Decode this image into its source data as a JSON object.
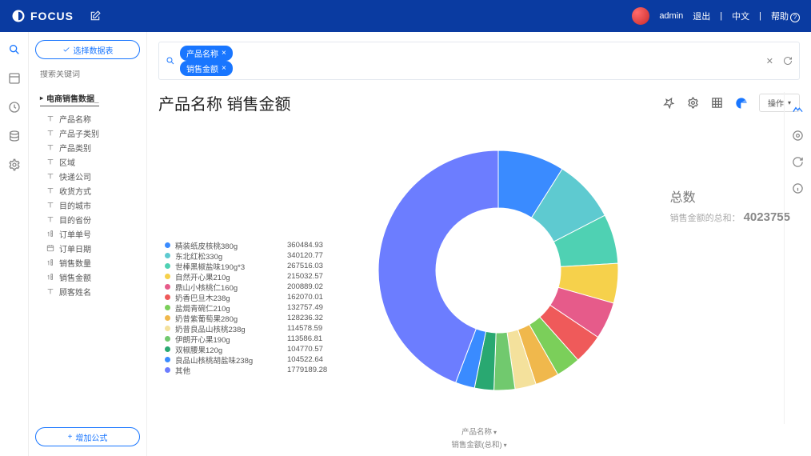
{
  "header": {
    "brand": "FOCUS",
    "user": "admin",
    "logout": "退出",
    "language": "中文",
    "help": "帮助"
  },
  "sidebar": {
    "selectDataBtn": "选择数据表",
    "searchPlaceholder": "搜索关键词",
    "treeTitle": "电商销售数据_",
    "fields": [
      {
        "label": "产品名称",
        "icon": "T"
      },
      {
        "label": "产品子类别",
        "icon": "T"
      },
      {
        "label": "产品类别",
        "icon": "T"
      },
      {
        "label": "区域",
        "icon": "T"
      },
      {
        "label": "快递公司",
        "icon": "T"
      },
      {
        "label": "收货方式",
        "icon": "T"
      },
      {
        "label": "目的城市",
        "icon": "T"
      },
      {
        "label": "目的省份",
        "icon": "T"
      },
      {
        "label": "订单单号",
        "icon": "num"
      },
      {
        "label": "订单日期",
        "icon": "cal"
      },
      {
        "label": "销售数量",
        "icon": "num"
      },
      {
        "label": "销售金额",
        "icon": "num"
      },
      {
        "label": "顾客姓名",
        "icon": "T"
      }
    ],
    "addFormula": "增加公式"
  },
  "chipbar": {
    "chips": [
      "产品名称",
      "销售金额"
    ]
  },
  "page": {
    "title": "产品名称 销售金额",
    "opBtn": "操作"
  },
  "summary": {
    "title": "总数",
    "label": "销售金额的总和：",
    "value": "4023755"
  },
  "axis": {
    "x": "产品名称",
    "y": "销售金额(总和)"
  },
  "chart_data": {
    "type": "pie",
    "title": "产品名称 销售金额",
    "series": [
      {
        "name": "精装纸皮核桃380g",
        "value": 360484.93,
        "color": "#3a8bff"
      },
      {
        "name": "东北红松330g",
        "value": 340120.77,
        "color": "#5ecad0"
      },
      {
        "name": "世棒黑椒盐味190g*3",
        "value": 267516.03,
        "color": "#4fd1b3"
      },
      {
        "name": "自然开心果210g",
        "value": 215032.57,
        "color": "#f6d14b"
      },
      {
        "name": "鼎山小核桃仁160g",
        "value": 200889.02,
        "color": "#e65b8a"
      },
      {
        "name": "奶香巴旦木238g",
        "value": 162070.01,
        "color": "#ef5a5a"
      },
      {
        "name": "盐焗青碗仁210g",
        "value": 132757.49,
        "color": "#7bcf5a"
      },
      {
        "name": "奶昔紫葡萄果280g",
        "value": 128236.32,
        "color": "#f0b84c"
      },
      {
        "name": "奶昔良品山核桃238g",
        "value": 114578.59,
        "color": "#f4e19c"
      },
      {
        "name": "伊朗开心果190g",
        "value": 113586.81,
        "color": "#71c96e"
      },
      {
        "name": "双椒腰果120g",
        "value": 104770.57,
        "color": "#29a871"
      },
      {
        "name": "良品山核桃胡盐味238g",
        "value": 104522.64,
        "color": "#3a8bff"
      },
      {
        "name": "其他",
        "value": 1779189.28,
        "color": "#6c7dff"
      }
    ],
    "total": 4023755
  }
}
